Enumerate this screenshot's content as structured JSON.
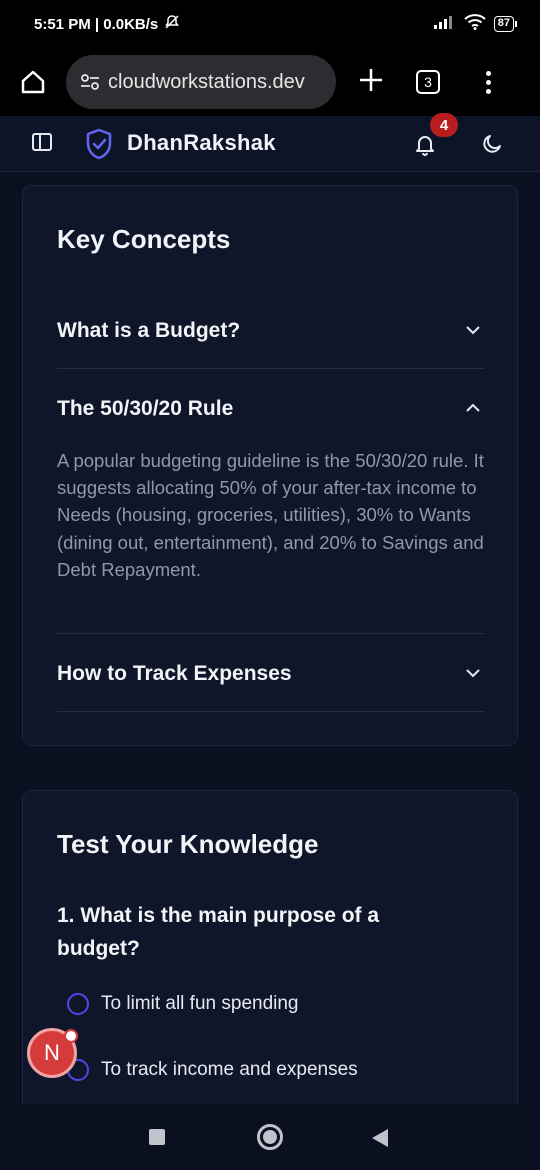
{
  "status": {
    "time_speed": "5:51 PM | 0.0KB/s",
    "battery": "87"
  },
  "browser": {
    "url": "cloudworkstations.dev",
    "tab_count": "3"
  },
  "app": {
    "name": "DhanRakshak",
    "notification_count": "4"
  },
  "key_concepts": {
    "title": "Key Concepts",
    "items": [
      {
        "question": "What is a Budget?",
        "expanded": false
      },
      {
        "question": "The 50/30/20 Rule",
        "expanded": true,
        "answer": "A popular budgeting guideline is the 50/30/20 rule. It suggests allocating 50% of your after-tax income to Needs (housing, groceries, utilities), 30% to Wants (dining out, entertainment), and 20% to Savings and Debt Repayment."
      },
      {
        "question": "How to Track Expenses",
        "expanded": false
      }
    ]
  },
  "quiz": {
    "title": "Test Your Knowledge",
    "question": "1. What is the main purpose of a budget?",
    "options": [
      "To limit all fun spending",
      "To track income and expenses"
    ]
  },
  "fab": {
    "label": "N"
  },
  "colors": {
    "background": "#0b1020",
    "card": "#0f1629",
    "accent": "#4f46e5",
    "badge": "#b91c1c"
  }
}
